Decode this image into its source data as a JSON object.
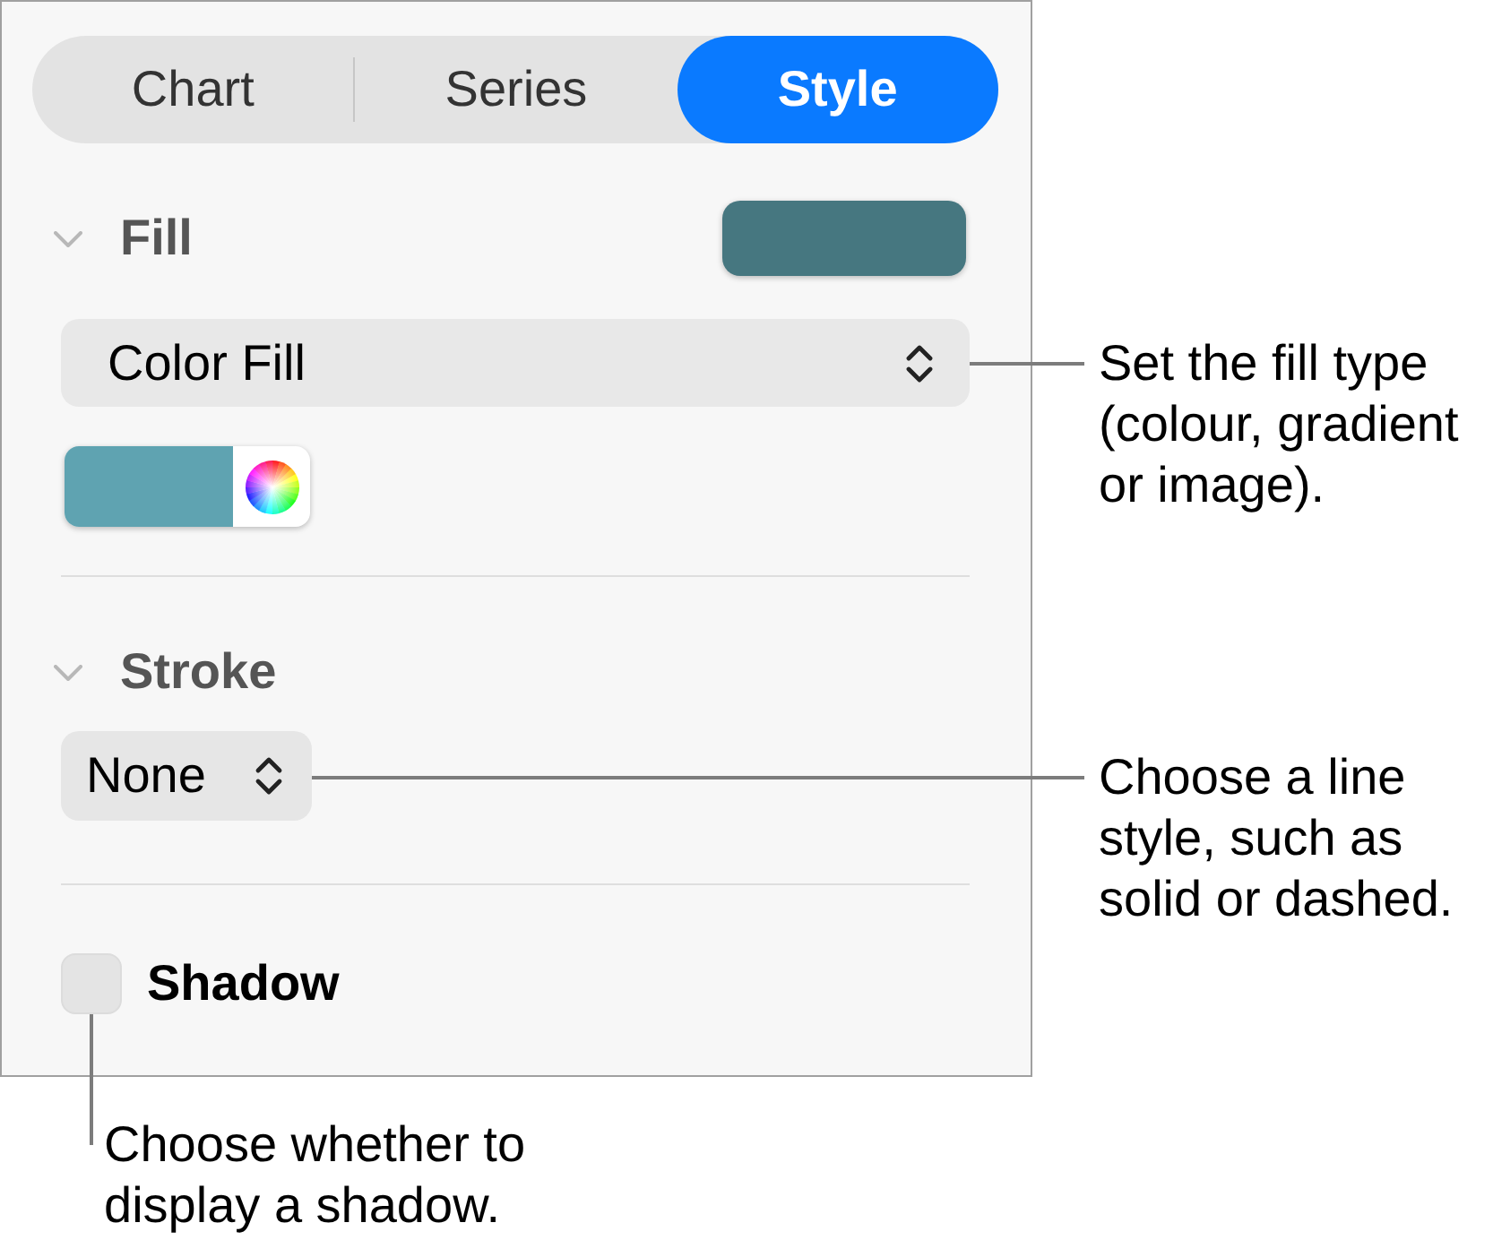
{
  "tabs": [
    {
      "label": "Chart",
      "selected": false
    },
    {
      "label": "Series",
      "selected": false
    },
    {
      "label": "Style",
      "selected": true
    }
  ],
  "fill": {
    "title": "Fill",
    "expanded": true,
    "color": "#467780",
    "fill_type": "Color Fill",
    "well": {
      "color": "#5fa3b1"
    },
    "callout": "Set the fill type\n(colour, gradient\nor image)."
  },
  "stroke": {
    "title": "Stroke",
    "expanded": true,
    "style": "None",
    "callout": "Choose a line\nstyle, such as\nsolid or dashed."
  },
  "shadow": {
    "label": "Shadow",
    "checked": false,
    "callout": "Choose whether to\ndisplay a shadow."
  }
}
